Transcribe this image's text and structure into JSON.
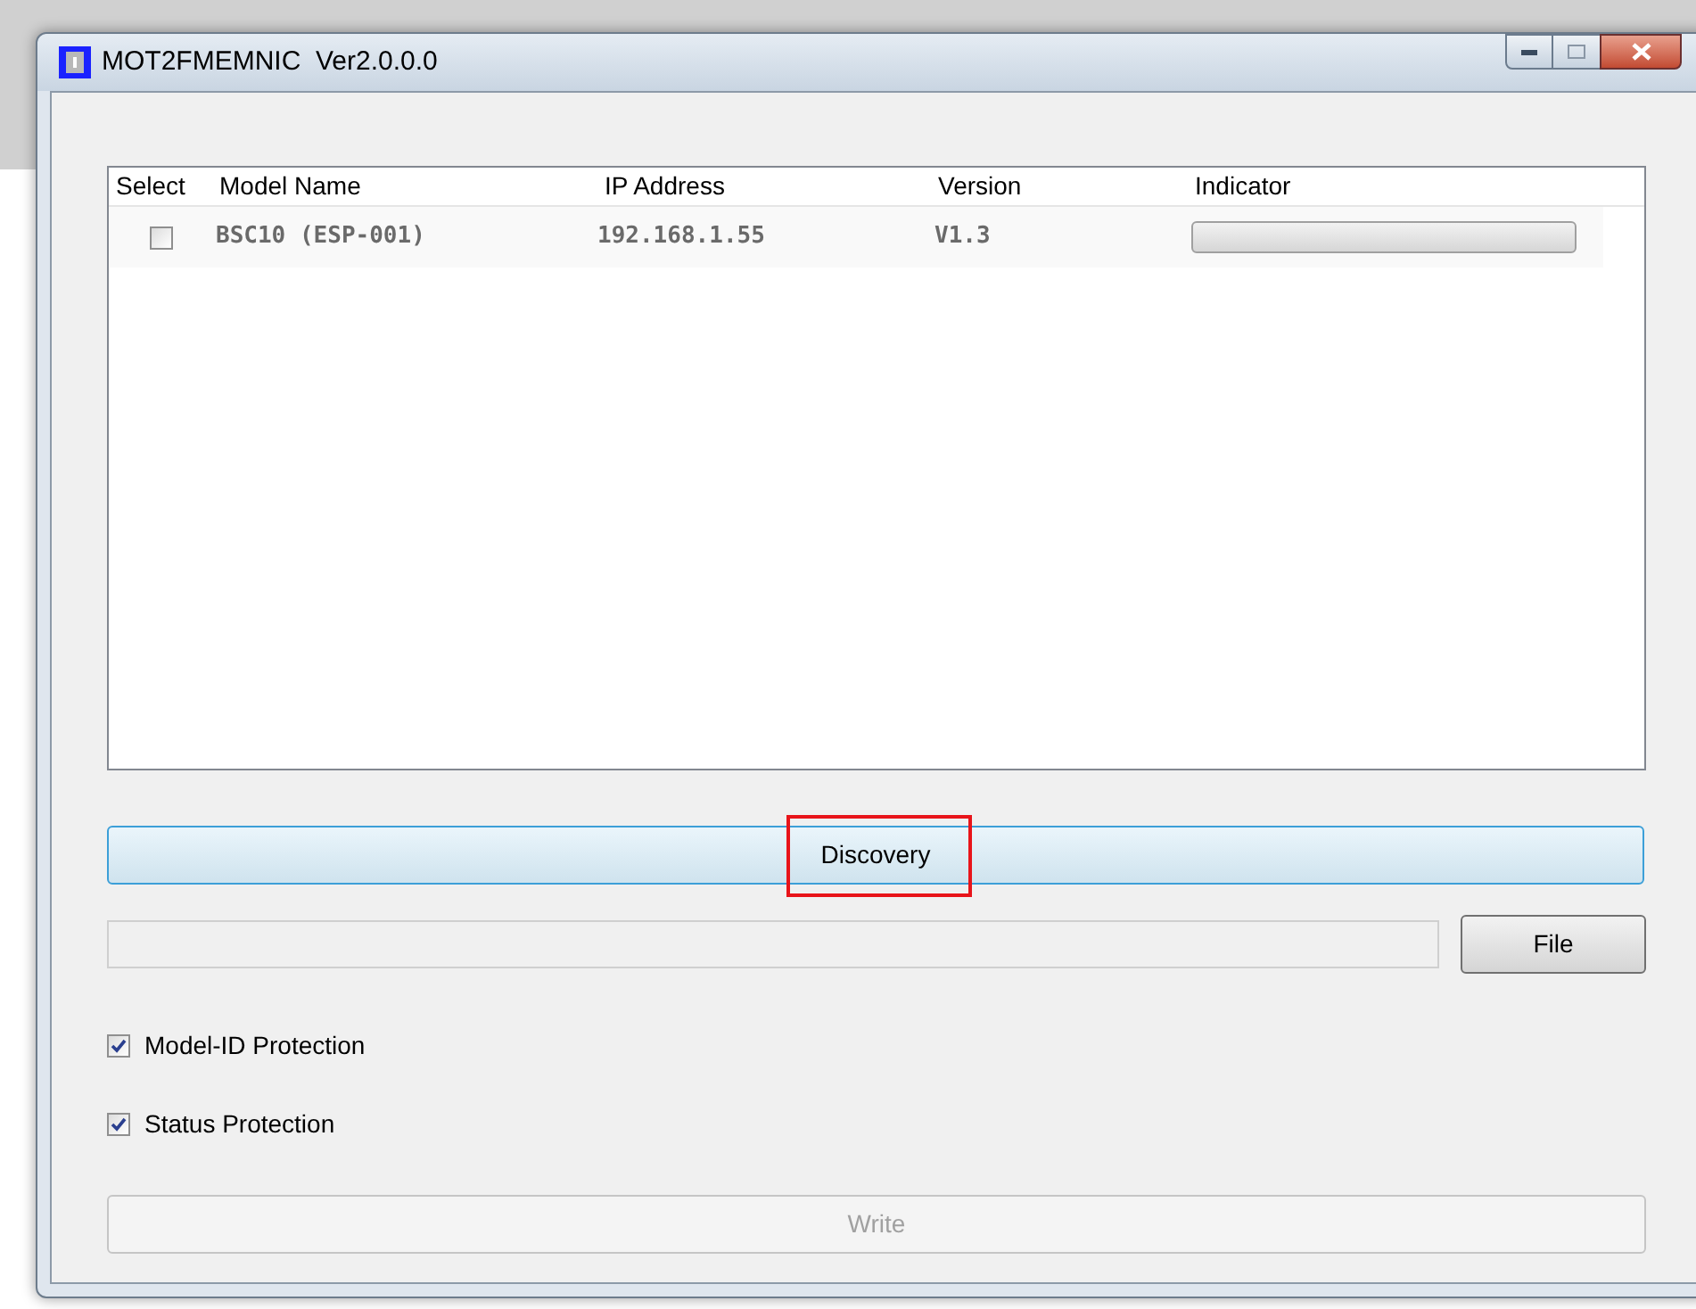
{
  "window": {
    "title": "MOT2FMEMNIC  Ver2.0.0.0"
  },
  "table": {
    "columns": [
      "Select",
      "Model Name",
      "IP Address",
      "Version",
      "Indicator"
    ],
    "rows": [
      {
        "checked": false,
        "model_name": "BSC10 (ESP-001)",
        "ip_address": "192.168.1.55",
        "version": "V1.3",
        "level": 0
      }
    ]
  },
  "discovery_button": {
    "label": "Discovery",
    "highlighted": true
  },
  "file_button": {
    "label": "File"
  },
  "options": [
    {
      "label": "Model-ID Protection",
      "checked": true
    },
    {
      "label": "Status Protection",
      "checked": true
    }
  ],
  "write_button": {
    "label": "Write",
    "disabled": true
  }
}
